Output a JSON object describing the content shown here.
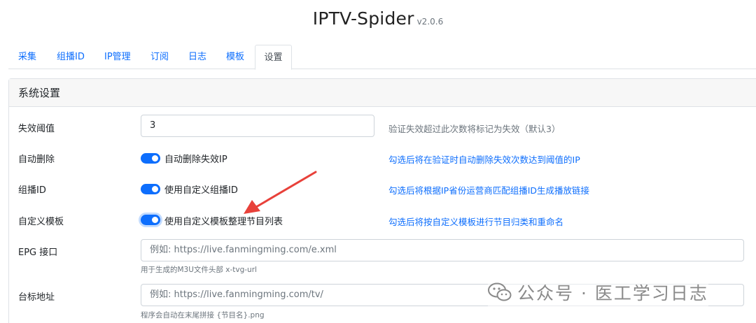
{
  "header": {
    "title": "IPTV-Spider",
    "version": "v2.0.6"
  },
  "tabs": [
    {
      "label": "采集"
    },
    {
      "label": "组播ID"
    },
    {
      "label": "IP管理"
    },
    {
      "label": "订阅"
    },
    {
      "label": "日志"
    },
    {
      "label": "模板"
    },
    {
      "label": "设置",
      "active": true
    }
  ],
  "settings": {
    "title": "系统设置",
    "fail_threshold": {
      "label": "失效阈值",
      "value": "3",
      "help": "验证失效超过此次数将标记为失效（默认3）"
    },
    "auto_delete": {
      "label": "自动删除",
      "toggle_label": "自动删除失效IP",
      "enabled": true,
      "help": "勾选后将在验证时自动删除失效次数达到阈值的IP"
    },
    "multicast_id": {
      "label": "组播ID",
      "toggle_label": "使用自定义组播ID",
      "enabled": true,
      "help": "勾选后将根据IP省份运营商匹配组播ID生成播放链接"
    },
    "custom_template": {
      "label": "自定义模板",
      "toggle_label": "使用自定义模板整理节目列表",
      "enabled": true,
      "help": "勾选后将按自定义模板进行节目归类和重命名"
    },
    "epg": {
      "label": "EPG 接口",
      "placeholder": "例如: https://live.fanmingming.com/e.xml",
      "help": "用于生成的M3U文件头部 x-tvg-url"
    },
    "logo_url": {
      "label": "台标地址",
      "placeholder": "例如: https://live.fanmingming.com/tv/",
      "help": "程序会自动在末尾拼接 {节目名}.png"
    }
  },
  "watermark": {
    "text": "公众号 · 医工学习日志",
    "icon": "wechat-icon"
  },
  "colors": {
    "accent": "#0d6efd",
    "annotation_arrow": "#e8413a",
    "muted": "#6c757d"
  }
}
